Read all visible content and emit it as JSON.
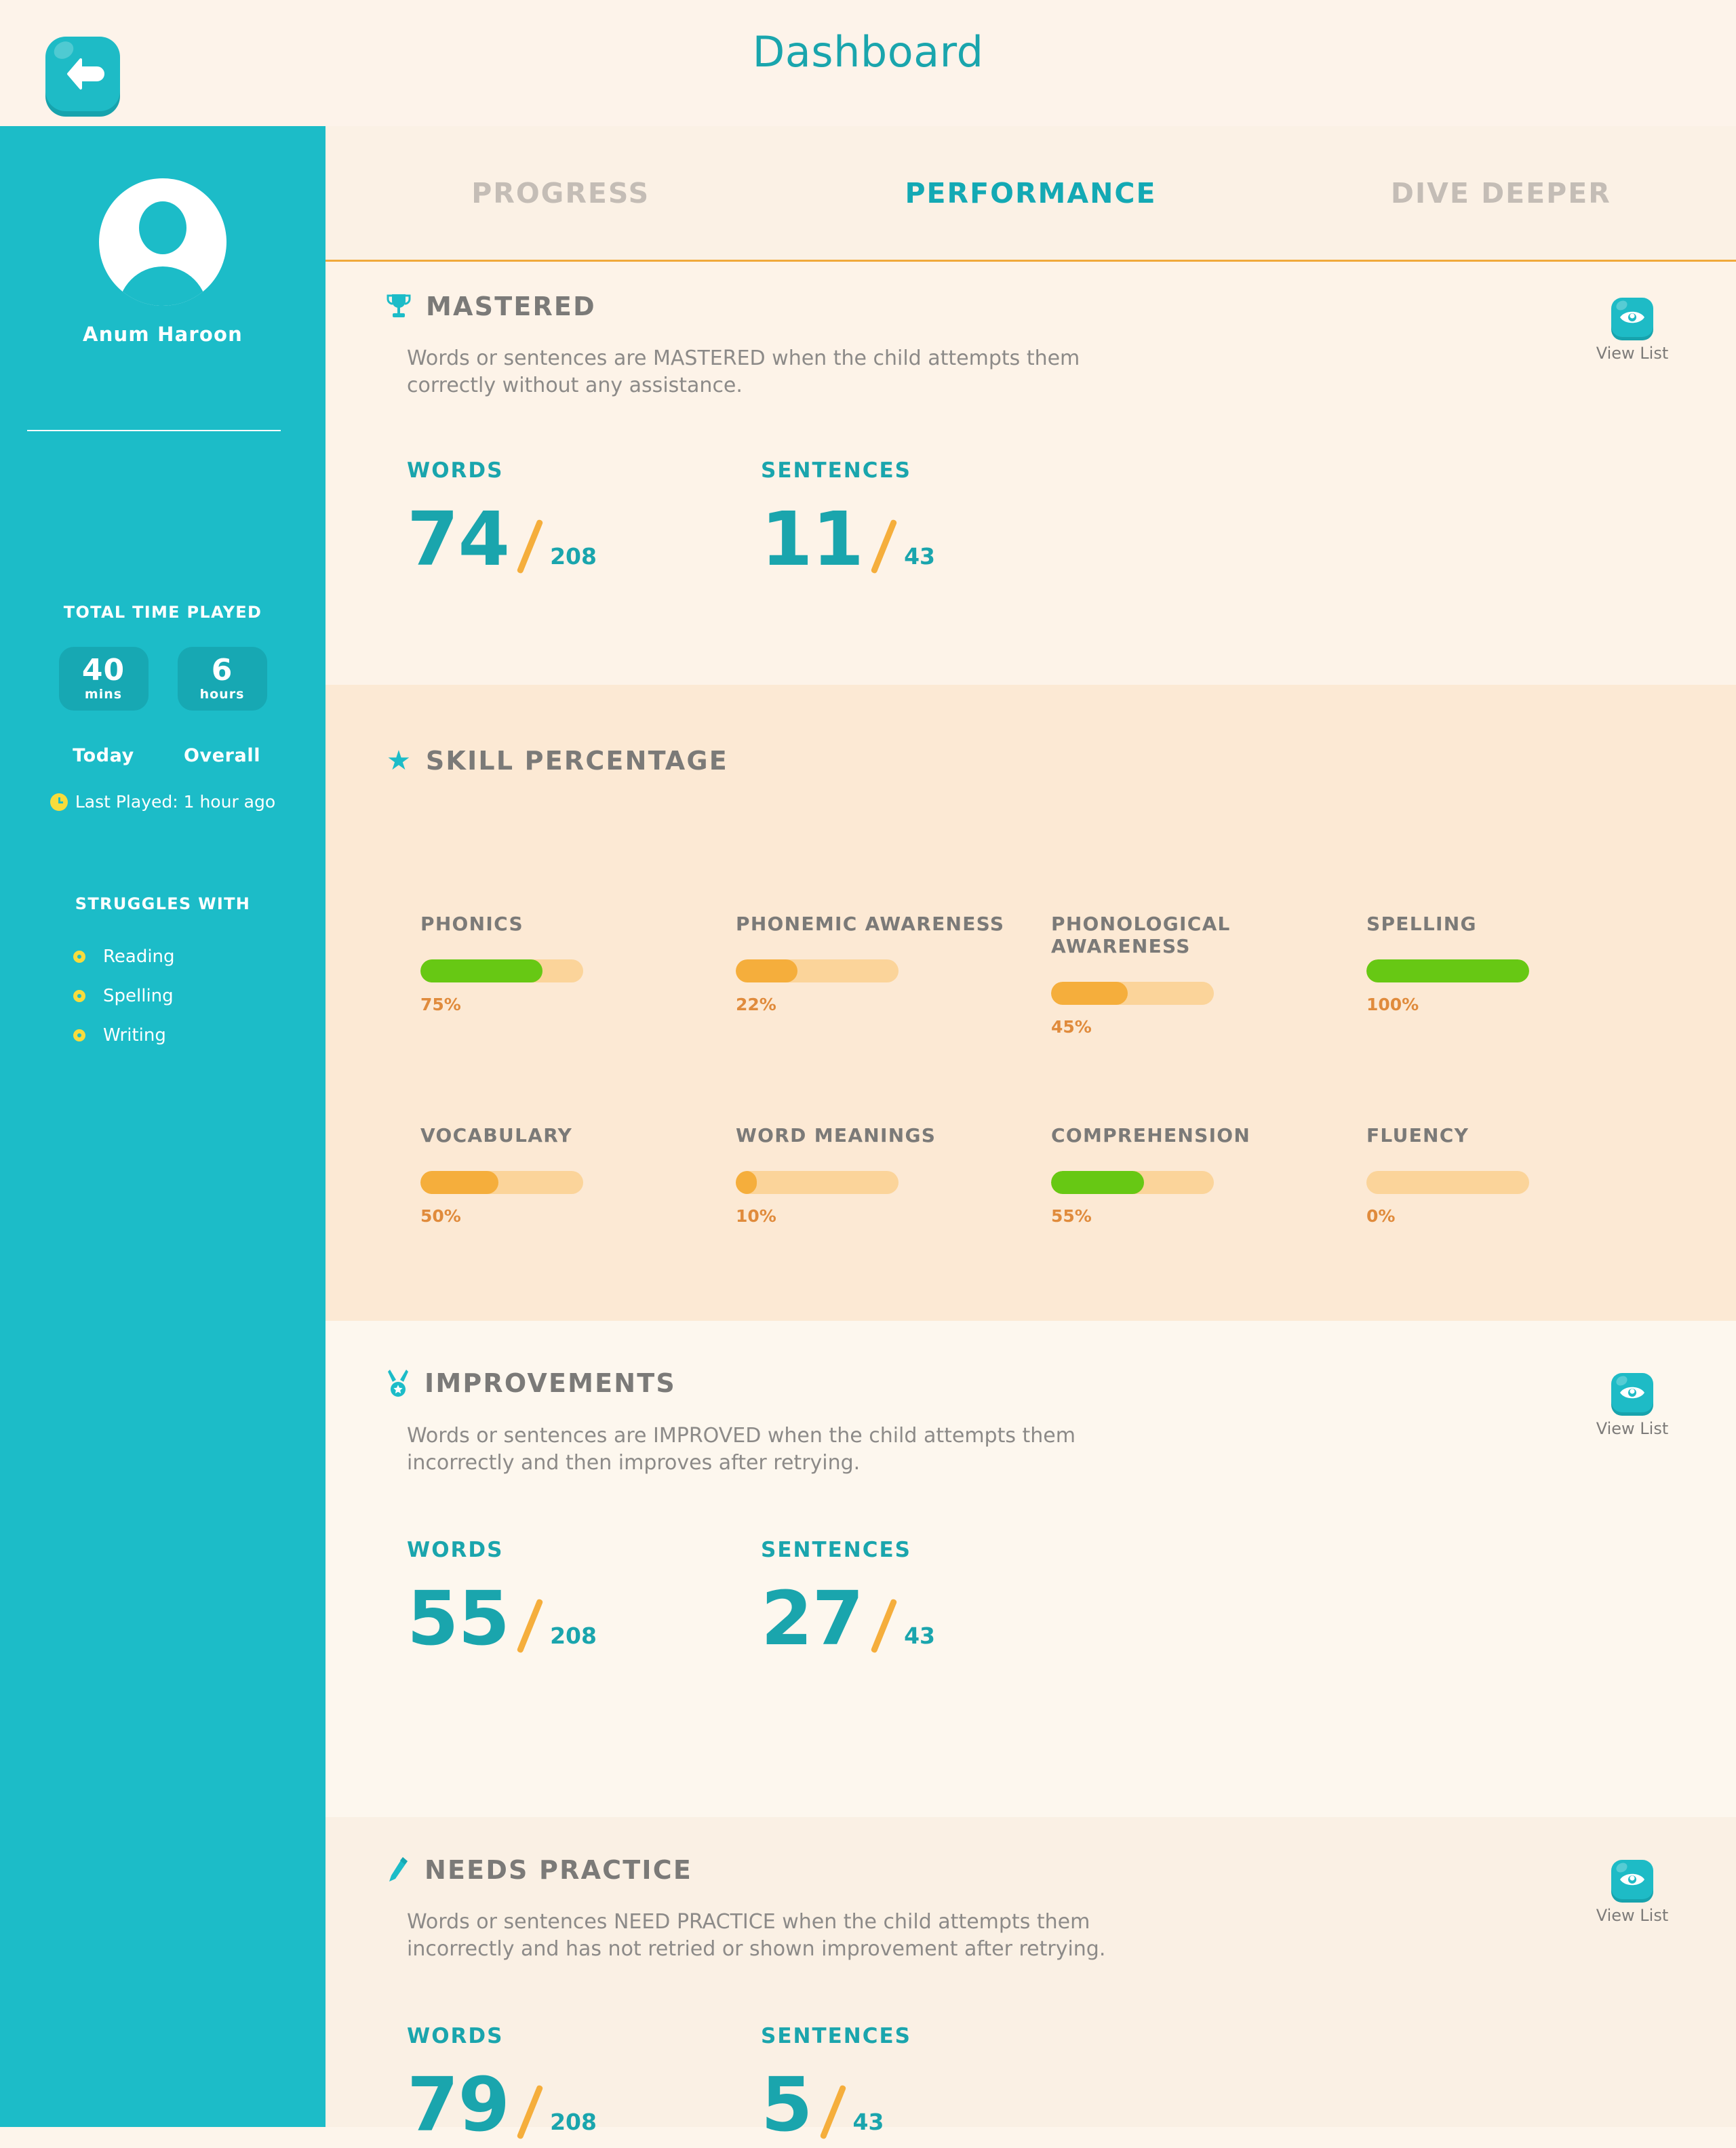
{
  "header": {
    "title": "Dashboard",
    "back_icon": "arrow-left-icon"
  },
  "sidebar": {
    "user_name": "Anum Haroon",
    "avatar_icon": "user-avatar-icon",
    "total_time_label": "TOTAL TIME PLAYED",
    "time_boxes": [
      {
        "value": "40",
        "unit": "mins",
        "caption": "Today"
      },
      {
        "value": "6",
        "unit": "hours",
        "caption": "Overall"
      }
    ],
    "last_played": "Last Played: 1 hour ago",
    "last_played_icon": "clock-icon",
    "struggles_label": "STRUGGLES WITH",
    "struggles": [
      "Reading",
      "Spelling",
      "Writing"
    ]
  },
  "tabs": [
    {
      "label": "PROGRESS",
      "active": false
    },
    {
      "label": "PERFORMANCE",
      "active": true
    },
    {
      "label": "DIVE DEEPER",
      "active": false
    }
  ],
  "view_list_label": "View List",
  "sections": {
    "mastered": {
      "title": "MASTERED",
      "icon": "trophy-icon",
      "description": "Words or sentences are MASTERED when the child attempts them\ncorrectly without any assistance.",
      "stats": [
        {
          "label": "WORDS",
          "value": "74",
          "total": "208"
        },
        {
          "label": "SENTENCES",
          "value": "11",
          "total": "43"
        }
      ]
    },
    "skill_percentage": {
      "title": "SKILL PERCENTAGE",
      "icon": "star-icon"
    },
    "improvements": {
      "title": "IMPROVEMENTS",
      "icon": "medal-icon",
      "description": "Words or sentences are IMPROVED when the child attempts them\nincorrectly and then improves after retrying.",
      "stats": [
        {
          "label": "WORDS",
          "value": "55",
          "total": "208"
        },
        {
          "label": "SENTENCES",
          "value": "27",
          "total": "43"
        }
      ]
    },
    "needs_practice": {
      "title": "NEEDS PRACTICE",
      "icon": "pencil-icon",
      "description": "Words or sentences NEED PRACTICE when the child attempts them\nincorrectly and has not retried or shown improvement after retrying.",
      "stats": [
        {
          "label": "WORDS",
          "value": "79",
          "total": "208"
        },
        {
          "label": "SENTENCES",
          "value": "5",
          "total": "43"
        }
      ]
    }
  },
  "colors": {
    "teal": "#1CBCC8",
    "teal_dark": "#1AA5AD",
    "cream": "#FDF5EB",
    "cream_dark": "#FCE9D4",
    "orange": "#F5AE3C",
    "orange_text": "#E08B3C",
    "green": "#67C814",
    "track": "#FBD49A",
    "gray_text": "#7B7A78",
    "yellow": "#F7DC3C"
  },
  "chart_data": {
    "type": "bar",
    "title": "SKILL PERCENTAGE",
    "xlabel": "",
    "ylabel": "",
    "ylim": [
      0,
      100
    ],
    "orientation": "horizontal",
    "categories": [
      "PHONICS",
      "PHONEMIC AWARENESS",
      "PHONOLOGICAL AWARENESS",
      "SPELLING",
      "VOCABULARY",
      "WORD MEANINGS",
      "COMPREHENSION",
      "FLUENCY"
    ],
    "values": [
      75,
      22,
      45,
      100,
      50,
      10,
      55,
      0
    ],
    "value_labels": [
      "75%",
      "22%",
      "45%",
      "100%",
      "50%",
      "10%",
      "55%",
      "0%"
    ],
    "bar_colors": [
      "#67C814",
      "#F5AE3C",
      "#F5AE3C",
      "#67C814",
      "#F5AE3C",
      "#F5AE3C",
      "#67C814",
      "#FBD49A"
    ],
    "track_color": "#FBD49A",
    "grid": false,
    "legend": false
  }
}
